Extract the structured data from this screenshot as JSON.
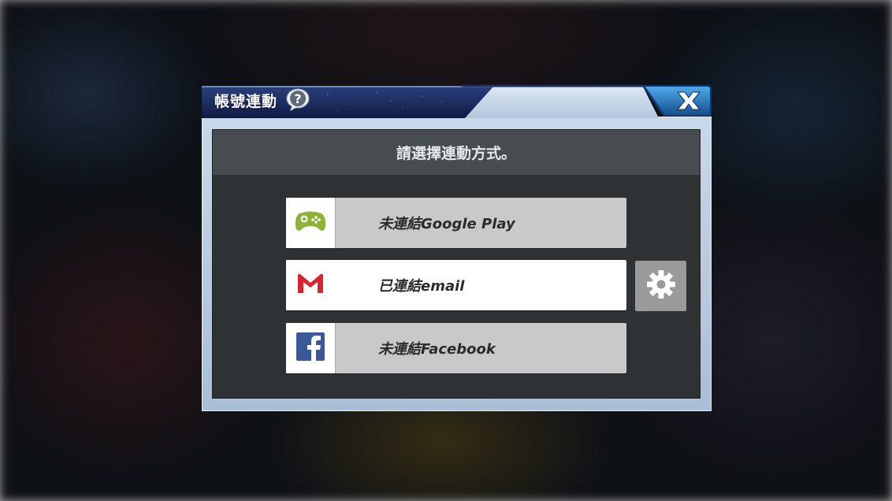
{
  "dialog": {
    "title": "帳號連動",
    "prompt": "請選擇連動方式。",
    "close_label": "X"
  },
  "options": [
    {
      "id": "google-play",
      "label": "未連結Google Play",
      "linked": false,
      "icon": "google-play-games-icon",
      "icon_color": "#8fb236"
    },
    {
      "id": "email",
      "label": "已連結email",
      "linked": true,
      "icon": "gmail-icon",
      "icon_color": "#d9232e"
    },
    {
      "id": "facebook",
      "label": "未連結Facebook",
      "linked": false,
      "icon": "facebook-icon",
      "icon_color": "#3b5998"
    }
  ],
  "colors": {
    "title_bar": "#17285a",
    "frame": "#b6c9de",
    "panel": "#2f3234",
    "panel_header": "#474c50",
    "close_button": "#1f6fb8"
  }
}
